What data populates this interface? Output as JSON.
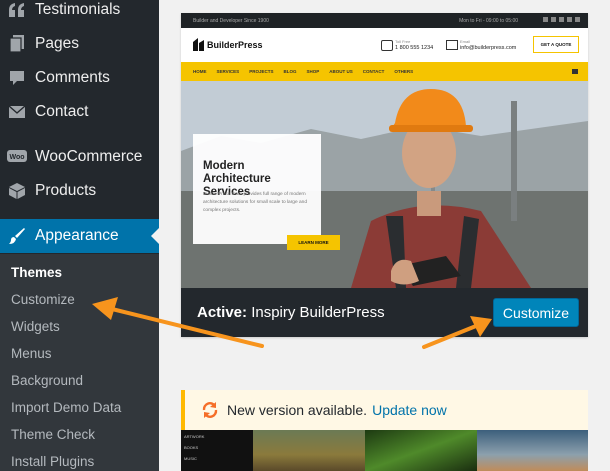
{
  "sidebar": {
    "items": [
      {
        "label": "Testimonials",
        "icon": "quote-icon"
      },
      {
        "label": "Pages",
        "icon": "pages-icon"
      },
      {
        "label": "Comments",
        "icon": "comments-icon"
      },
      {
        "label": "Contact",
        "icon": "mail-icon"
      },
      {
        "label": "WooCommerce",
        "icon": "woocommerce-icon"
      },
      {
        "label": "Products",
        "icon": "box-icon"
      },
      {
        "label": "Appearance",
        "icon": "paintbrush-icon"
      }
    ],
    "submenu": [
      "Themes",
      "Customize",
      "Widgets",
      "Menus",
      "Background",
      "Import Demo Data",
      "Theme Check",
      "Install Plugins"
    ]
  },
  "theme_card": {
    "screenshot": {
      "topbar_left": "Builder and Developer Since 1900",
      "topbar_right": "Mon to Fri - 09:00 to 05:00",
      "logo": "BuilderPress",
      "phone_label": "Toll Free",
      "phone": "1 800 555 1234",
      "email_label": "Email",
      "email": "info@builderpress.com",
      "quote_button": "GET A QUOTE",
      "nav": [
        "HOME",
        "SERVICES",
        "PROJECTS",
        "BLOG",
        "SHOP",
        "ABOUT US",
        "CONTACT",
        "OTHERS"
      ],
      "hero_title": "Modern Architecture Services",
      "hero_text": "BuilderPress team provides full range of modern architecture solutions for small scale to large and complex projects.",
      "hero_button": "LEARN MORE"
    },
    "active_prefix": "Active:",
    "active_name": "Inspiry BuilderPress",
    "customize_button": "Customize"
  },
  "notice": {
    "text": "New version available.",
    "link": "Update now"
  },
  "theme2_menu": [
    "ARTWORK",
    "BOOKS",
    "MUSIC"
  ],
  "colors": {
    "sidebar_bg": "#23282d",
    "submenu_bg": "#32373c",
    "active_blue": "#0073aa",
    "button_blue": "#0085ba",
    "theme_yellow": "#f5c400",
    "arrow_orange": "#f7941d"
  }
}
